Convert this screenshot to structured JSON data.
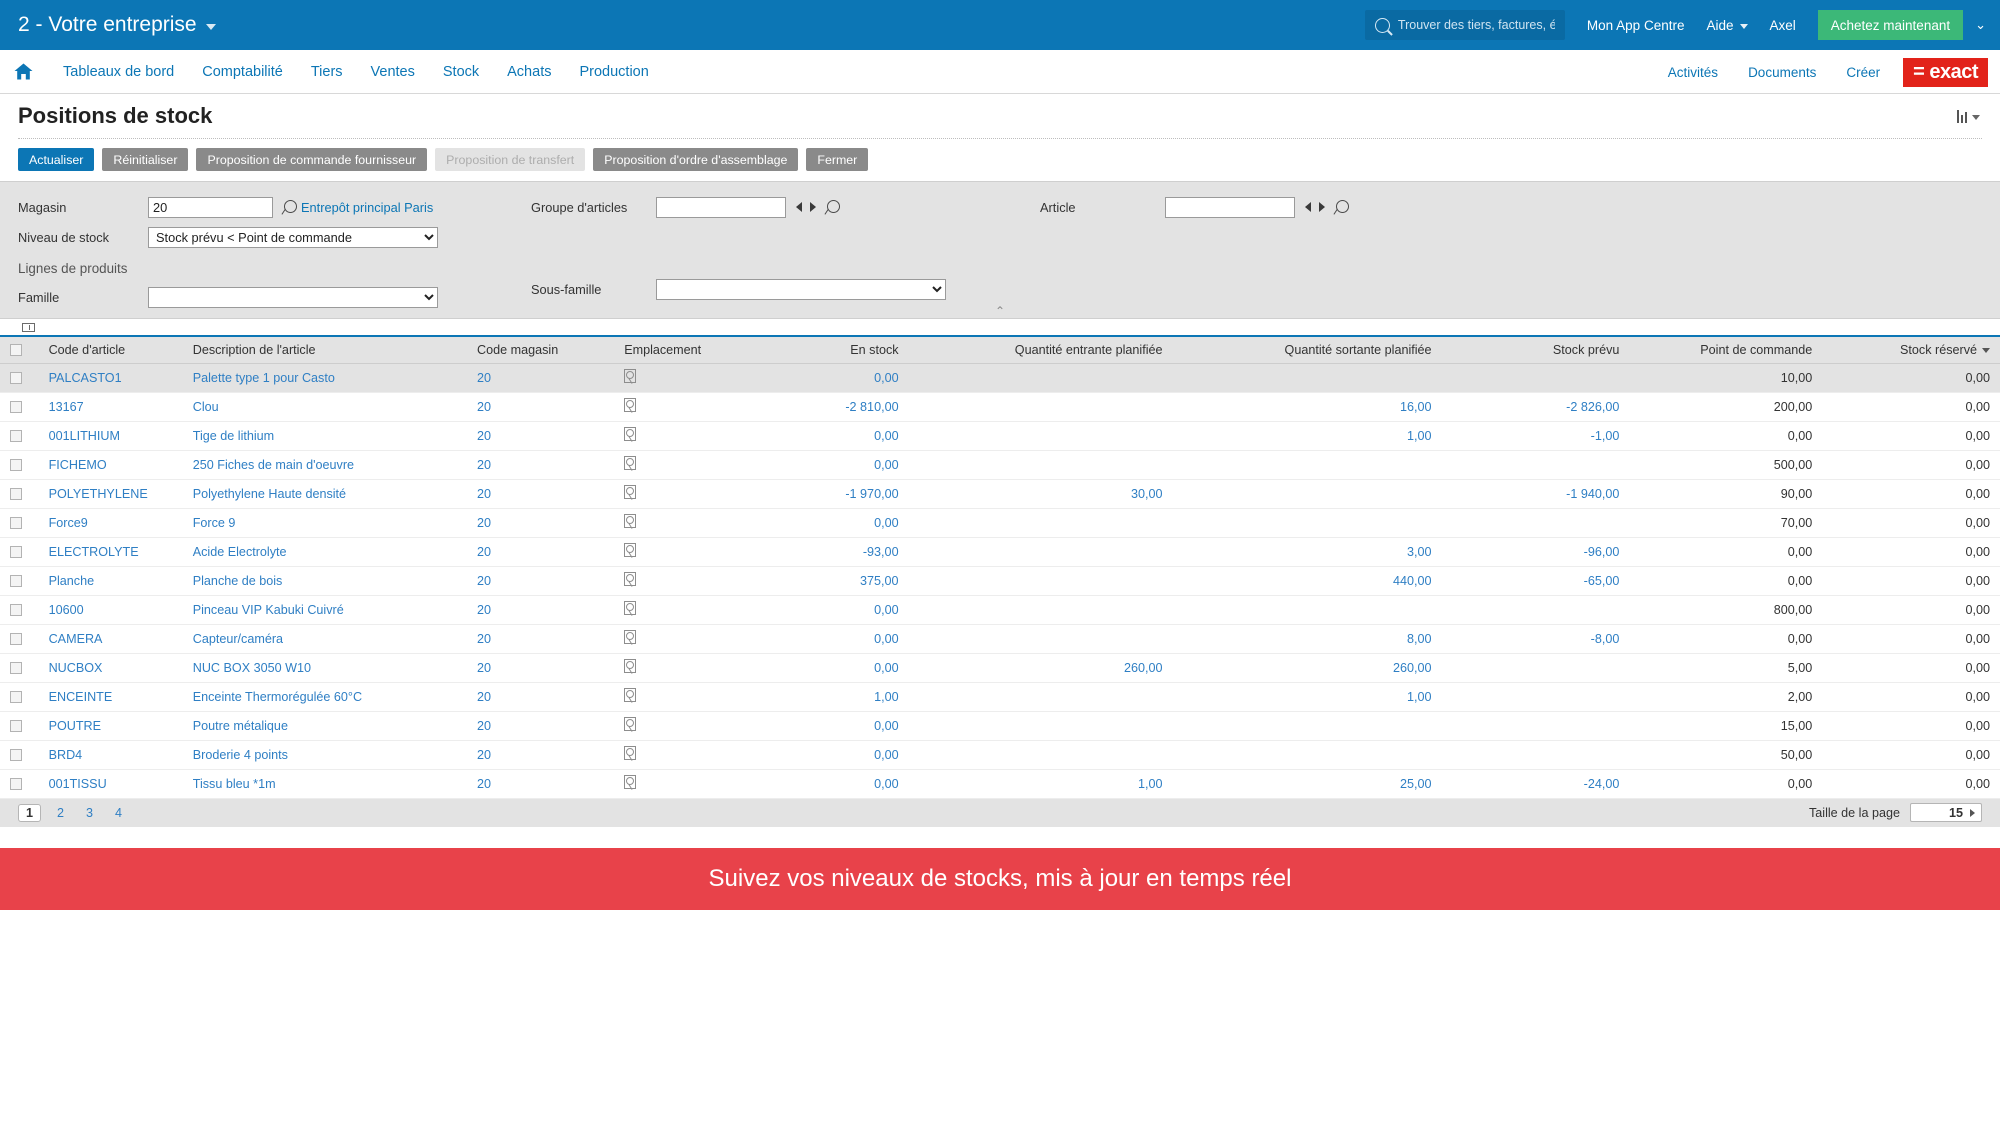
{
  "topbar": {
    "company": "2 - Votre entreprise",
    "search_placeholder": "Trouver des tiers, factures, écr...",
    "app_centre": "Mon App Centre",
    "help": "Aide",
    "user": "Axel",
    "buy_now": "Achetez maintenant"
  },
  "nav": {
    "items": [
      {
        "label": "Tableaux de bord"
      },
      {
        "label": "Comptabilité"
      },
      {
        "label": "Tiers"
      },
      {
        "label": "Ventes"
      },
      {
        "label": "Stock"
      },
      {
        "label": "Achats"
      },
      {
        "label": "Production"
      }
    ],
    "right": [
      {
        "label": "Activités"
      },
      {
        "label": "Documents"
      },
      {
        "label": "Créer"
      }
    ],
    "logo": "= exact"
  },
  "page": {
    "title": "Positions de stock"
  },
  "toolbar": {
    "refresh": "Actualiser",
    "reset": "Réinitialiser",
    "supplier_order": "Proposition de commande fournisseur",
    "transfer": "Proposition de transfert",
    "assembly_order": "Proposition d'ordre d'assemblage",
    "close": "Fermer"
  },
  "filters": {
    "warehouse_label": "Magasin",
    "warehouse_value": "20",
    "warehouse_name": "Entrepôt principal Paris",
    "stock_level_label": "Niveau de stock",
    "stock_level_value": "Stock prévu < Point de commande",
    "product_lines_label": "Lignes de produits",
    "family_label": "Famille",
    "family_value": "",
    "item_group_label": "Groupe d'articles",
    "item_group_value": "",
    "subfamily_label": "Sous-famille",
    "subfamily_value": "",
    "article_label": "Article",
    "article_value": ""
  },
  "table": {
    "columns": [
      {
        "key": "code",
        "label": "Code d'article",
        "align": "left"
      },
      {
        "key": "description",
        "label": "Description de l'article",
        "align": "left"
      },
      {
        "key": "warehouse",
        "label": "Code magasin",
        "align": "left"
      },
      {
        "key": "location",
        "label": "Emplacement",
        "align": "left"
      },
      {
        "key": "in_stock",
        "label": "En stock",
        "align": "right"
      },
      {
        "key": "planned_in",
        "label": "Quantité entrante planifiée",
        "align": "right"
      },
      {
        "key": "planned_out",
        "label": "Quantité sortante planifiée",
        "align": "right"
      },
      {
        "key": "forecast",
        "label": "Stock prévu",
        "align": "right"
      },
      {
        "key": "reorder_point",
        "label": "Point de commande",
        "align": "right"
      },
      {
        "key": "reserved",
        "label": "Stock réservé",
        "align": "right",
        "sorted": true
      }
    ],
    "rows": [
      {
        "selected": true,
        "code": "PALCASTO1",
        "description": "Palette type 1 pour Casto",
        "warehouse": "20",
        "in_stock": "0,00",
        "planned_in": "",
        "planned_out": "",
        "forecast": "",
        "reorder_point": "10,00",
        "reserved": "0,00"
      },
      {
        "selected": false,
        "code": "13167",
        "description": "Clou",
        "warehouse": "20",
        "in_stock": "-2 810,00",
        "planned_in": "",
        "planned_out": "16,00",
        "forecast": "-2 826,00",
        "reorder_point": "200,00",
        "reserved": "0,00"
      },
      {
        "selected": false,
        "code": "001LITHIUM",
        "description": "Tige de lithium",
        "warehouse": "20",
        "in_stock": "0,00",
        "planned_in": "",
        "planned_out": "1,00",
        "forecast": "-1,00",
        "reorder_point": "0,00",
        "reserved": "0,00"
      },
      {
        "selected": false,
        "code": "FICHEMO",
        "description": "250 Fiches de main d'oeuvre",
        "warehouse": "20",
        "in_stock": "0,00",
        "planned_in": "",
        "planned_out": "",
        "forecast": "",
        "reorder_point": "500,00",
        "reserved": "0,00"
      },
      {
        "selected": false,
        "code": "POLYETHYLENE",
        "description": "Polyethylene Haute densité",
        "warehouse": "20",
        "in_stock": "-1 970,00",
        "planned_in": "30,00",
        "planned_out": "",
        "forecast": "-1 940,00",
        "reorder_point": "90,00",
        "reserved": "0,00"
      },
      {
        "selected": false,
        "code": "Force9",
        "description": "Force 9",
        "warehouse": "20",
        "in_stock": "0,00",
        "planned_in": "",
        "planned_out": "",
        "forecast": "",
        "reorder_point": "70,00",
        "reserved": "0,00"
      },
      {
        "selected": false,
        "code": "ELECTROLYTE",
        "description": "Acide Electrolyte",
        "warehouse": "20",
        "in_stock": "-93,00",
        "planned_in": "",
        "planned_out": "3,00",
        "forecast": "-96,00",
        "reorder_point": "0,00",
        "reserved": "0,00"
      },
      {
        "selected": false,
        "code": "Planche",
        "description": "Planche de bois",
        "warehouse": "20",
        "in_stock": "375,00",
        "planned_in": "",
        "planned_out": "440,00",
        "forecast": "-65,00",
        "reorder_point": "0,00",
        "reserved": "0,00"
      },
      {
        "selected": false,
        "code": "10600",
        "description": "Pinceau VIP Kabuki Cuivré",
        "warehouse": "20",
        "in_stock": "0,00",
        "planned_in": "",
        "planned_out": "",
        "forecast": "",
        "reorder_point": "800,00",
        "reserved": "0,00"
      },
      {
        "selected": false,
        "code": "CAMERA",
        "description": "Capteur/caméra",
        "warehouse": "20",
        "in_stock": "0,00",
        "planned_in": "",
        "planned_out": "8,00",
        "forecast": "-8,00",
        "reorder_point": "0,00",
        "reserved": "0,00"
      },
      {
        "selected": false,
        "code": "NUCBOX",
        "description": "NUC BOX 3050 W10",
        "warehouse": "20",
        "in_stock": "0,00",
        "planned_in": "260,00",
        "planned_out": "260,00",
        "forecast": "",
        "reorder_point": "5,00",
        "reserved": "0,00"
      },
      {
        "selected": false,
        "code": "ENCEINTE",
        "description": "Enceinte Thermorégulée 60°C",
        "warehouse": "20",
        "in_stock": "1,00",
        "planned_in": "",
        "planned_out": "1,00",
        "forecast": "",
        "reorder_point": "2,00",
        "reserved": "0,00"
      },
      {
        "selected": false,
        "code": "POUTRE",
        "description": "Poutre métalique",
        "warehouse": "20",
        "in_stock": "0,00",
        "planned_in": "",
        "planned_out": "",
        "forecast": "",
        "reorder_point": "15,00",
        "reserved": "0,00"
      },
      {
        "selected": false,
        "code": "BRD4",
        "description": "Broderie 4 points",
        "warehouse": "20",
        "in_stock": "0,00",
        "planned_in": "",
        "planned_out": "",
        "forecast": "",
        "reorder_point": "50,00",
        "reserved": "0,00"
      },
      {
        "selected": false,
        "code": "001TISSU",
        "description": "Tissu bleu *1m",
        "warehouse": "20",
        "in_stock": "0,00",
        "planned_in": "1,00",
        "planned_out": "25,00",
        "forecast": "-24,00",
        "reorder_point": "0,00",
        "reserved": "0,00"
      }
    ]
  },
  "pager": {
    "pages": [
      "1",
      "2",
      "3",
      "4"
    ],
    "active_page": "1",
    "page_size_label": "Taille de la page",
    "page_size_value": "15"
  },
  "banner": {
    "text": "Suivez vos niveaux de stocks, mis à jour en temps réel"
  },
  "colors": {
    "header_blue": "#0c76b5",
    "accent_green": "#3cb878",
    "logo_red": "#e2231a",
    "banner_red": "#e8424a",
    "link_blue": "#2f7fc4"
  }
}
